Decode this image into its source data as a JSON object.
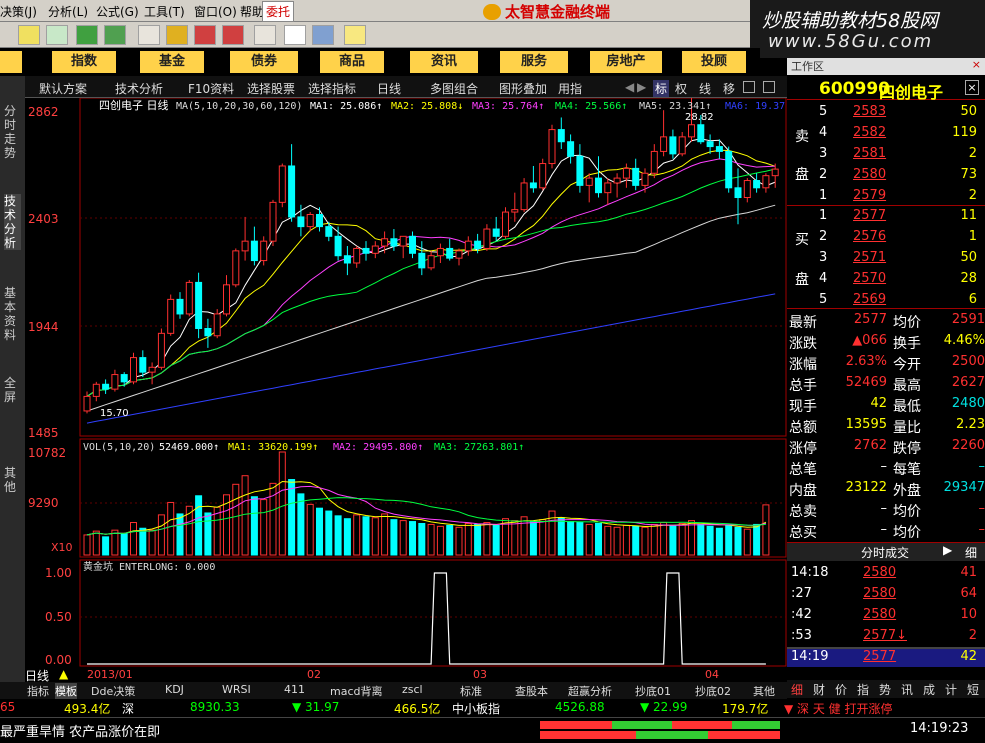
{
  "menubar": {
    "items": [
      "决策(J)",
      "分析(L)",
      "公式(G)",
      "工具(T)",
      "窗口(O)",
      "帮助(H)"
    ],
    "entrust": "委托",
    "brand": "太智慧金融终端"
  },
  "watermark": {
    "line1": "炒股辅助教材58股网",
    "line2": "www.58Gu.com"
  },
  "nav": {
    "items": [
      "股",
      "指数",
      "基金",
      "债券",
      "商品",
      "资讯",
      "服务",
      "房地产",
      "投顾"
    ]
  },
  "left_tabs": [
    "分时走势",
    "技术分析",
    "基本资料",
    "全屏",
    "其他"
  ],
  "subtoolbar": {
    "items": [
      "默认方案",
      "技术分析",
      "F10资料",
      "选择股票",
      "选择指标",
      "日线",
      "多图组合",
      "图形叠加",
      "用指"
    ],
    "right": [
      "标",
      "权",
      "线",
      "移"
    ]
  },
  "chart_header": {
    "title": "四创电子 日线",
    "ma_params": "MA(5,10,20,30,60,120)",
    "ma1": "MA1: 25.086↑",
    "ma2": "MA2: 25.808↓",
    "ma3": "MA3: 25.764↑",
    "ma4": "MA4: 25.566↑",
    "ma5": "MA5: 23.341↑",
    "ma6": "MA6: 19.37"
  },
  "price_axis": [
    "2862",
    "2403",
    "1944",
    "1485"
  ],
  "annotations": {
    "high": "28.82",
    "low": "15.70"
  },
  "vol_header": {
    "params": "VOL(5,10,20)",
    "vol": "52469.000↑",
    "ma1": "MA1: 33620.199↑",
    "ma2": "MA2: 29495.800↑",
    "ma3": "MA3: 27263.801↑"
  },
  "vol_axis": [
    "10782",
    "9290",
    "X10"
  ],
  "ind_header": "黄金坑 ENTERLONG: 0.000",
  "ind_axis": [
    "1.00",
    "0.50",
    "0.00"
  ],
  "time_axis": {
    "period": "日线",
    "labels": [
      "2013/01",
      "02",
      "03",
      "04"
    ]
  },
  "bottom_tabs": [
    "指标",
    "模板",
    "Dde决策",
    "KDJ",
    "WRSI",
    "411",
    "macd背离",
    "zscl",
    "标准",
    "查股本",
    "超赢分析",
    "抄底01",
    "抄底02",
    "其他"
  ],
  "right_panel": {
    "title": "工作区",
    "code": "600990",
    "name": "四创电子",
    "sell_label": [
      "卖",
      "盘"
    ],
    "buy_label": [
      "买",
      "盘"
    ],
    "asks": [
      {
        "lv": "5",
        "price": "2583",
        "vol": "50"
      },
      {
        "lv": "4",
        "price": "2582",
        "vol": "119"
      },
      {
        "lv": "3",
        "price": "2581",
        "vol": "2"
      },
      {
        "lv": "2",
        "price": "2580",
        "vol": "73"
      },
      {
        "lv": "1",
        "price": "2579",
        "vol": "2"
      }
    ],
    "bids": [
      {
        "lv": "1",
        "price": "2577",
        "vol": "11"
      },
      {
        "lv": "2",
        "price": "2576",
        "vol": "1"
      },
      {
        "lv": "3",
        "price": "2571",
        "vol": "50"
      },
      {
        "lv": "4",
        "price": "2570",
        "vol": "28"
      },
      {
        "lv": "5",
        "price": "2569",
        "vol": "6"
      }
    ],
    "stats": [
      [
        "最新",
        "2577",
        "均价",
        "2591"
      ],
      [
        "涨跌",
        "▲066",
        "换手",
        "4.46%"
      ],
      [
        "涨幅",
        "2.63%",
        "今开",
        "2500"
      ],
      [
        "总手",
        "52469",
        "最高",
        "2627"
      ],
      [
        "现手",
        "42",
        "最低",
        "2480"
      ],
      [
        "总额",
        "13595",
        "量比",
        "2.23"
      ],
      [
        "涨停",
        "2762",
        "跌停",
        "2260"
      ],
      [
        "总笔",
        "–",
        "每笔",
        "–"
      ],
      [
        "内盘",
        "23122",
        "外盘",
        "29347"
      ],
      [
        "总卖",
        "–",
        "均价",
        "–"
      ],
      [
        "总买",
        "–",
        "均价",
        "–"
      ]
    ],
    "ticks_title": "分时成交",
    "ticks_right": "细",
    "ticks": [
      {
        "t": "14:18",
        "p": "2580",
        "v": "41"
      },
      {
        "t": ":27",
        "p": "2580",
        "v": "64"
      },
      {
        "t": ":42",
        "p": "2580",
        "v": "10"
      },
      {
        "t": ":53",
        "p": "2577↓",
        "v": "2"
      },
      {
        "t": "14:19",
        "p": "2577",
        "v": "42"
      }
    ],
    "tabs": [
      "细",
      "财",
      "价",
      "指",
      "势",
      "讯",
      "成",
      "计",
      "短"
    ]
  },
  "status": {
    "a": "65",
    "b": "493.4亿",
    "c": "深",
    "d": "8930.33",
    "e": "▼ 31.97",
    "f": "466.5亿",
    "g": "中小板指",
    "h": "4526.88",
    "i": "▼ 22.99",
    "j": "179.7亿",
    "k": "▼ 深 天 健 打开涨停"
  },
  "ticker": {
    "text": "最严重旱情 农产品涨价在即",
    "time": "14:19:23"
  },
  "chart_data": {
    "type": "candlestick",
    "title": "四创电子 日线",
    "ohlc": [
      [
        15.8,
        16.6,
        15.7,
        16.4
      ],
      [
        16.4,
        17.0,
        16.2,
        16.9
      ],
      [
        16.9,
        17.1,
        16.5,
        16.7
      ],
      [
        16.7,
        17.5,
        16.6,
        17.3
      ],
      [
        17.3,
        17.4,
        16.8,
        17.0
      ],
      [
        17.0,
        18.2,
        16.9,
        18.0
      ],
      [
        18.0,
        18.3,
        17.2,
        17.4
      ],
      [
        17.4,
        17.8,
        16.9,
        17.6
      ],
      [
        17.6,
        19.2,
        17.5,
        19.0
      ],
      [
        19.0,
        20.6,
        18.9,
        20.4
      ],
      [
        20.4,
        20.7,
        19.6,
        19.8
      ],
      [
        19.8,
        21.2,
        19.7,
        21.1
      ],
      [
        21.1,
        21.5,
        18.8,
        19.2
      ],
      [
        19.2,
        19.6,
        18.4,
        18.9
      ],
      [
        18.9,
        20.0,
        18.8,
        19.8
      ],
      [
        19.8,
        21.4,
        19.7,
        21.0
      ],
      [
        21.0,
        22.5,
        20.9,
        22.4
      ],
      [
        22.4,
        23.8,
        22.0,
        22.8
      ],
      [
        22.8,
        23.4,
        21.8,
        22.0
      ],
      [
        22.0,
        23.0,
        21.8,
        22.8
      ],
      [
        22.8,
        24.5,
        22.6,
        24.4
      ],
      [
        24.4,
        26.0,
        24.2,
        25.9
      ],
      [
        25.9,
        26.8,
        23.6,
        23.8
      ],
      [
        23.8,
        24.3,
        23.0,
        23.4
      ],
      [
        23.4,
        24.0,
        23.2,
        23.9
      ],
      [
        23.9,
        24.2,
        23.2,
        23.4
      ],
      [
        23.4,
        23.6,
        22.8,
        23.0
      ],
      [
        23.0,
        23.4,
        22.0,
        22.2
      ],
      [
        22.2,
        22.6,
        21.4,
        21.9
      ],
      [
        21.9,
        22.6,
        21.7,
        22.5
      ],
      [
        22.5,
        22.8,
        22.0,
        22.3
      ],
      [
        22.3,
        22.8,
        22.1,
        22.6
      ],
      [
        22.6,
        23.2,
        22.3,
        22.9
      ],
      [
        22.9,
        23.3,
        22.4,
        22.6
      ],
      [
        22.6,
        23.0,
        22.1,
        23.0
      ],
      [
        23.0,
        23.2,
        22.1,
        22.3
      ],
      [
        22.3,
        22.8,
        21.4,
        21.7
      ],
      [
        21.7,
        22.4,
        21.6,
        22.2
      ],
      [
        22.2,
        22.7,
        21.9,
        22.5
      ],
      [
        22.5,
        22.9,
        22.0,
        22.1
      ],
      [
        22.1,
        22.5,
        21.8,
        22.4
      ],
      [
        22.4,
        23.0,
        22.2,
        22.8
      ],
      [
        22.8,
        23.1,
        22.3,
        22.5
      ],
      [
        22.5,
        23.5,
        22.4,
        23.3
      ],
      [
        23.3,
        23.8,
        22.8,
        23.0
      ],
      [
        23.0,
        24.2,
        22.9,
        24.0
      ],
      [
        24.0,
        24.8,
        23.6,
        24.1
      ],
      [
        24.1,
        25.4,
        24.0,
        25.2
      ],
      [
        25.2,
        25.9,
        24.8,
        25.0
      ],
      [
        25.0,
        26.2,
        24.9,
        26.0
      ],
      [
        26.0,
        27.6,
        25.8,
        27.4
      ],
      [
        27.4,
        27.9,
        26.6,
        26.9
      ],
      [
        26.9,
        27.2,
        26.0,
        26.3
      ],
      [
        26.3,
        26.8,
        24.8,
        25.1
      ],
      [
        25.1,
        25.6,
        24.4,
        25.4
      ],
      [
        25.4,
        26.3,
        24.6,
        24.8
      ],
      [
        24.8,
        25.4,
        24.3,
        25.2
      ],
      [
        25.2,
        25.6,
        24.6,
        25.4
      ],
      [
        25.4,
        26.0,
        25.0,
        25.8
      ],
      [
        25.8,
        26.2,
        24.9,
        25.1
      ],
      [
        25.1,
        25.8,
        24.8,
        25.6
      ],
      [
        25.6,
        26.8,
        25.4,
        26.5
      ],
      [
        26.5,
        28.2,
        26.3,
        27.1
      ],
      [
        27.1,
        27.4,
        26.2,
        26.4
      ],
      [
        26.4,
        27.3,
        26.3,
        27.1
      ],
      [
        27.1,
        28.82,
        26.9,
        27.6
      ],
      [
        27.6,
        28.0,
        26.8,
        26.9
      ],
      [
        26.9,
        27.2,
        26.4,
        26.7
      ],
      [
        26.7,
        27.0,
        26.2,
        26.5
      ],
      [
        26.5,
        26.7,
        24.8,
        25.0
      ],
      [
        25.0,
        25.8,
        23.5,
        24.6
      ],
      [
        24.6,
        25.4,
        24.4,
        25.3
      ],
      [
        25.3,
        25.6,
        24.8,
        25.0
      ],
      [
        25.0,
        25.6,
        24.8,
        25.5
      ],
      [
        25.5,
        26.0,
        25.0,
        25.77
      ]
    ],
    "volume": [
      2100,
      2500,
      1900,
      2600,
      2200,
      3400,
      2800,
      2600,
      4200,
      5500,
      4300,
      5100,
      6200,
      4400,
      5000,
      6300,
      7400,
      8300,
      6100,
      5800,
      7500,
      10782,
      7900,
      6400,
      5300,
      4900,
      4600,
      4100,
      3800,
      4200,
      4000,
      3900,
      4300,
      3700,
      3600,
      3500,
      3300,
      3200,
      3000,
      3100,
      2900,
      3300,
      3200,
      3400,
      3100,
      3800,
      3600,
      4000,
      3500,
      3700,
      4600,
      3900,
      3500,
      3400,
      3200,
      3300,
      3000,
      2900,
      3100,
      3000,
      2900,
      3200,
      3400,
      3100,
      3300,
      3600,
      3200,
      3000,
      2800,
      3100,
      2900,
      2700,
      3200,
      5247
    ],
    "enterlong": [
      0,
      0,
      0,
      0,
      0,
      0,
      0,
      0,
      0,
      0,
      0,
      0,
      0,
      0,
      0,
      0,
      0,
      0,
      0,
      0,
      0,
      0,
      0,
      0,
      0,
      0,
      0,
      0,
      0,
      0,
      0,
      0,
      0,
      0,
      0,
      0,
      0,
      0,
      1,
      0,
      0,
      0,
      0,
      0,
      0,
      0,
      0,
      0,
      0,
      0,
      0,
      0,
      0,
      0,
      0,
      0,
      0,
      0,
      0,
      0,
      0,
      0,
      0,
      1,
      0,
      0,
      0,
      0,
      0,
      0,
      0,
      0,
      0,
      0
    ],
    "price_ylim": [
      14.85,
      28.62
    ],
    "vol_ylim": [
      0,
      10782
    ],
    "ma_colors": [
      "#ffffff",
      "#ffff00",
      "#ff40ff",
      "#00ff40",
      "#d8d8d8",
      "#3040ff"
    ]
  }
}
